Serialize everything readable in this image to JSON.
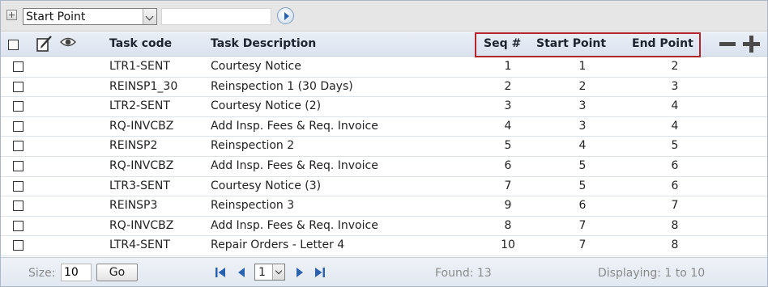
{
  "toolbar": {
    "field_select_value": "Start Point",
    "filter_value": ""
  },
  "header": {
    "task_code": "Task code",
    "task_description": "Task Description",
    "seq": "Seq #",
    "start_point": "Start Point",
    "end_point": "End Point"
  },
  "rows": [
    {
      "task_code": "LTR1-SENT",
      "task_description": "Courtesy Notice",
      "seq": "1",
      "start_point": "1",
      "end_point": "2"
    },
    {
      "task_code": "REINSP1_30",
      "task_description": "Reinspection 1 (30 Days)",
      "seq": "2",
      "start_point": "2",
      "end_point": "3"
    },
    {
      "task_code": "LTR2-SENT",
      "task_description": "Courtesy Notice (2)",
      "seq": "3",
      "start_point": "3",
      "end_point": "4"
    },
    {
      "task_code": "RQ-INVCBZ",
      "task_description": "Add Insp. Fees & Req. Invoice",
      "seq": "4",
      "start_point": "3",
      "end_point": "4"
    },
    {
      "task_code": "REINSP2",
      "task_description": "Reinspection 2",
      "seq": "5",
      "start_point": "4",
      "end_point": "5"
    },
    {
      "task_code": "RQ-INVCBZ",
      "task_description": "Add Insp. Fees & Req. Invoice",
      "seq": "6",
      "start_point": "5",
      "end_point": "6"
    },
    {
      "task_code": "LTR3-SENT",
      "task_description": "Courtesy Notice (3)",
      "seq": "7",
      "start_point": "5",
      "end_point": "6"
    },
    {
      "task_code": "REINSP3",
      "task_description": "Reinspection 3",
      "seq": "9",
      "start_point": "6",
      "end_point": "7"
    },
    {
      "task_code": "RQ-INVCBZ",
      "task_description": "Add Insp. Fees & Req. Invoice",
      "seq": "8",
      "start_point": "7",
      "end_point": "8"
    },
    {
      "task_code": "LTR4-SENT",
      "task_description": "Repair Orders - Letter 4",
      "seq": "10",
      "start_point": "7",
      "end_point": "8"
    }
  ],
  "footer": {
    "size_label": "Size:",
    "size_value": "10",
    "go_label": "Go",
    "page_value": "1",
    "found_text": "Found: 13",
    "displaying_text": "Displaying: 1 to 10"
  },
  "colors": {
    "highlight_border": "#b2252f",
    "header_bg": "#dbe3ef",
    "pager_blue": "#2a62b0"
  },
  "icons": {
    "expand": "plus-square-icon",
    "edit": "edit-note-icon",
    "view": "eye-icon",
    "go": "arrow-circle-right-icon",
    "remove_row": "minus-icon",
    "add_row": "plus-icon",
    "first": "first-page-icon",
    "prev": "previous-page-icon",
    "next": "next-page-icon",
    "last": "last-page-icon"
  }
}
